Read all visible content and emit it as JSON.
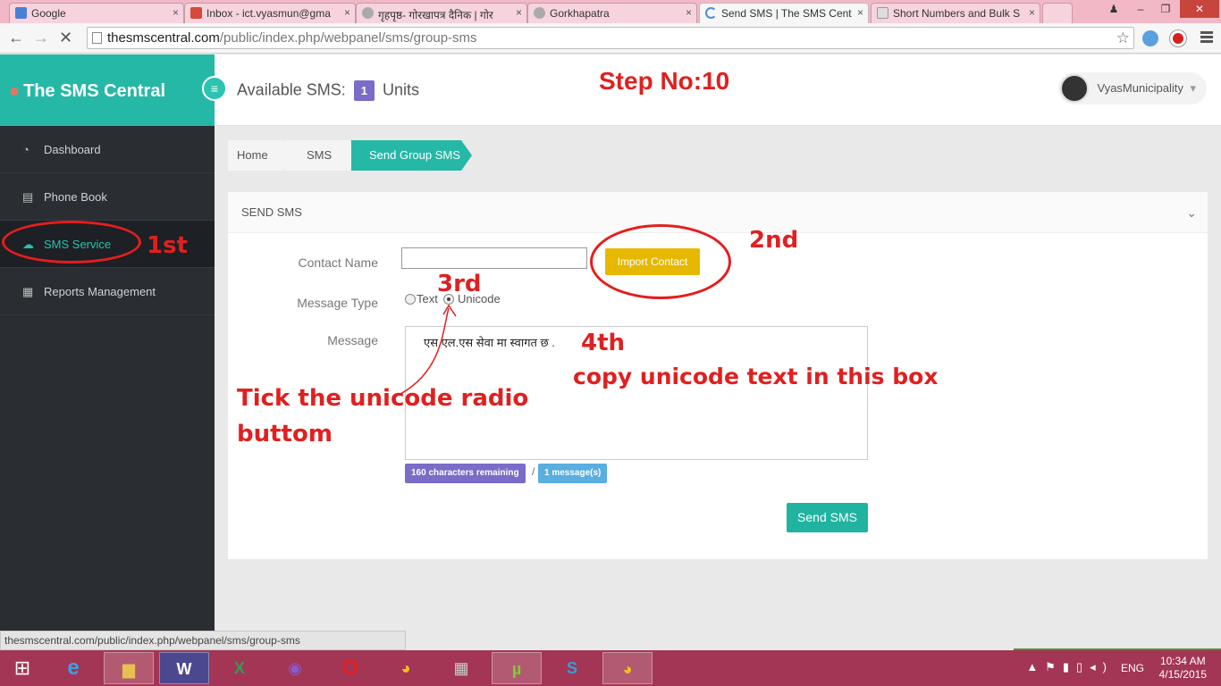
{
  "browser": {
    "tabs": [
      {
        "label": "Google",
        "color": "#4a7fd6"
      },
      {
        "label": "Inbox - ict.vyasmun@gma",
        "color": "#d54a3a"
      },
      {
        "label": "गृहपृष्ठ- गोरखापत्र दैनिक | गोर",
        "color": "#888888"
      },
      {
        "label": "Gorkhapatra",
        "color": "#888888"
      },
      {
        "label": "Send SMS | The SMS Cent",
        "color": "#4a90d9"
      },
      {
        "label": "Short Numbers and Bulk S",
        "color": "#888888"
      }
    ],
    "url_host": "thesmscentral.com",
    "url_path": "/public/index.php/webpanel/sms/group-sms",
    "back_icon": "←",
    "forward_icon": "→",
    "reload_icon": "✕",
    "star_icon": "☆",
    "close_glyph": "×"
  },
  "app": {
    "brand": "The SMS Central",
    "available_label": "Available SMS:",
    "available_count": "1",
    "available_unit": "Units",
    "user_name": "VyasMunicipality",
    "user_caret": "▾"
  },
  "sidebar": {
    "items": [
      {
        "label": "Dashboard",
        "icon": "◔"
      },
      {
        "label": "Phone Book",
        "icon": "▤"
      },
      {
        "label": "SMS Service",
        "icon": "☁"
      },
      {
        "label": "Reports Management",
        "icon": "▦"
      }
    ]
  },
  "breadcrumb": [
    "Home",
    "SMS",
    "Send Group SMS"
  ],
  "form": {
    "panel_title": "SEND SMS",
    "contact_label": "Contact Name",
    "contact_value": "",
    "import_button": "Import Contact",
    "message_type_label": "Message Type",
    "type_text": "Text",
    "type_unicode": "Unicode",
    "selected_type": "Unicode",
    "message_label": "Message",
    "message_value": "एस.एल.एस सेवा मा स्वागत छ .",
    "chars_remaining": "160 characters remaining",
    "separator": "/",
    "messages_count": "1 message(s)",
    "send_button": "Send SMS"
  },
  "annotations": {
    "step": "Step No:10",
    "first": "1st",
    "second": "2nd",
    "third": "3rd",
    "fourth": "4th",
    "copy_hint": "copy unicode  text in this box",
    "tick_hint_1": "Tick the unicode radio",
    "tick_hint_2": "buttom"
  },
  "status_url": "thesmscentral.com/public/index.php/webpanel/sms/group-sms",
  "taskbar": {
    "lang": "ENG",
    "time": "10:34 AM",
    "date": "4/15/2015"
  },
  "colors": {
    "accent": "#26b8a6",
    "sidebar": "#2a2e33",
    "import": "#e6b800",
    "annotation": "#e02020"
  }
}
